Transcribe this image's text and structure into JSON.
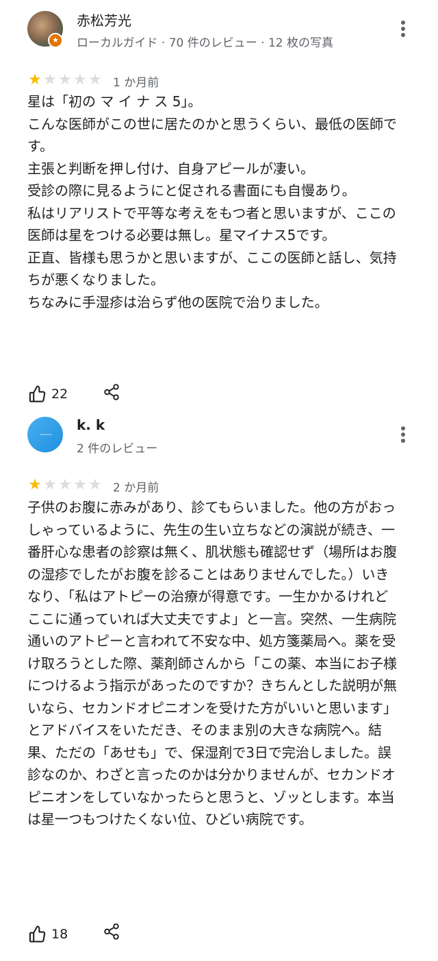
{
  "reviews": [
    {
      "author": "赤松芳光",
      "meta": "ローカルガイド · 70 件のレビュー · 12 枚の写真",
      "rating": 1,
      "date": "1 か月前",
      "paragraphs": [
        "星は「初の マ イ ナ ス 5」。",
        "こんな医師がこの世に居たのかと思うくらい、最低の医師です。",
        "主張と判断を押し付け、自身アピールが凄い。",
        "受診の際に見るようにと促される書面にも自慢あり。",
        "私はリアリストで平等な考えをもつ者と思いますが、ここの医師は星をつける必要は無し。星マイナス5です。",
        "正直、皆様も思うかと思いますが、ここの医師と話し、気持ちが悪くなりました。",
        "ちなみに手湿疹は治らず他の医院で治りました。"
      ],
      "likes": "22",
      "avatar_icon": "user-photo-avatar",
      "badge_icon": "local-guide-star-icon"
    },
    {
      "author": "k. k",
      "meta": "2 件のレビュー",
      "rating": 1,
      "date": "2 か月前",
      "paragraphs": [
        "子供のお腹に赤みがあり、診てもらいました。他の方がおっしゃっているように、先生の生い立ちなどの演説が続き、一番肝心な患者の診察は無く、肌状態も確認せず（場所はお腹の湿疹でしたがお腹を診ることはありませんでした。）いきなり、「私はアトピーの治療が得意です。一生かかるけれどここに通っていれば大丈夫ですよ」と一言。突然、一生病院通いのアトピーと言われて不安な中、処方箋薬局へ。薬を受け取ろうとした際、薬剤師さんから「この薬、本当にお子様につけるよう指示があったのですか？きちんとした説明が無いなら、セカンドオピニオンを受けた方がいいと思います」とアドバイスをいただき、そのまま別の大きな病院へ。結果、ただの「あせも」で、保湿剤で3日で完治しました。誤診なのか、わざと言ったのかは分かりませんが、セカンドオピニオンをしていなかったらと思うと、ゾッとします。本当は星一つもつけたくない位、ひどい病院です。"
      ],
      "likes": "18",
      "avatar_icon": "blue-circle-avatar"
    }
  ],
  "colors": {
    "star_filled": "#fbbc04",
    "star_empty": "#dadce0",
    "secondary_text": "#5f6368",
    "local_guide_badge": "#e37400"
  }
}
